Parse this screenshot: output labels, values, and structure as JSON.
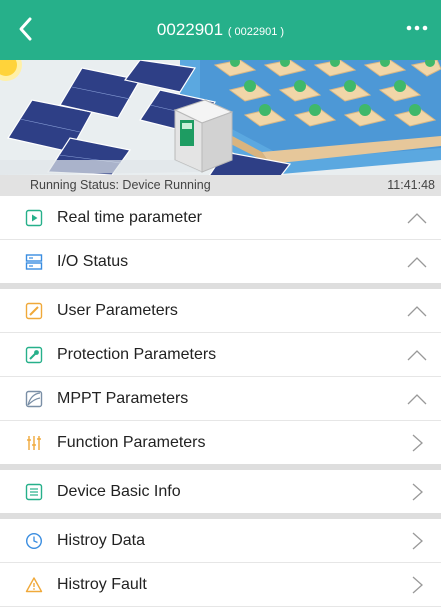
{
  "header": {
    "title": "0022901",
    "subtitle": "( 0022901 )",
    "background": "#26b08a"
  },
  "status": {
    "label": "Running Status:  Device Running",
    "time": "11:41:48"
  },
  "icons": {
    "back": "chevron-left-icon",
    "more": "more-dots-icon"
  },
  "menu": [
    {
      "label": "Real time parameter",
      "icon": "play-box-icon",
      "state": "expanded"
    },
    {
      "label": "I/O Status",
      "icon": "server-icon",
      "state": "expanded"
    },
    {
      "label": "User Parameters",
      "icon": "edit-icon",
      "state": "expanded"
    },
    {
      "label": "Protection Parameters",
      "icon": "wrench-icon",
      "state": "expanded"
    },
    {
      "label": "MPPT Parameters",
      "icon": "chart-icon",
      "state": "expanded"
    },
    {
      "label": "Function Parameters",
      "icon": "sliders-icon",
      "state": "collapsed"
    },
    {
      "label": "Device Basic Info",
      "icon": "list-icon",
      "state": "collapsed"
    },
    {
      "label": "Histroy Data",
      "icon": "clock-icon",
      "state": "collapsed"
    },
    {
      "label": "Histroy Fault",
      "icon": "warning-icon",
      "state": "collapsed"
    }
  ]
}
